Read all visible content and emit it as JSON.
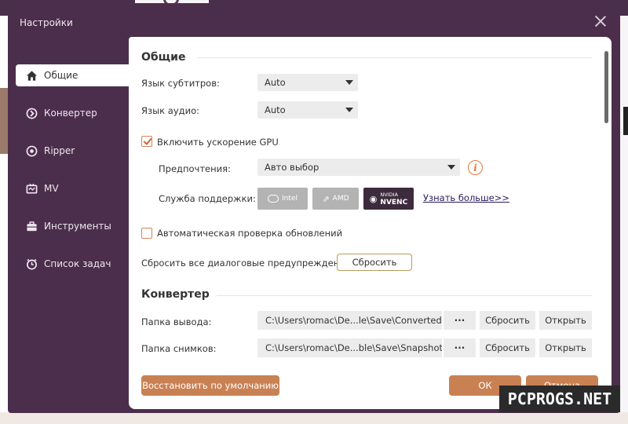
{
  "window": {
    "title": "Настройки"
  },
  "sidebar": {
    "items": [
      {
        "label": "Общие",
        "icon": "home-icon",
        "active": true
      },
      {
        "label": "Конвертер",
        "icon": "converter-icon",
        "active": false
      },
      {
        "label": "Ripper",
        "icon": "disc-icon",
        "active": false
      },
      {
        "label": "MV",
        "icon": "tv-icon",
        "active": false
      },
      {
        "label": "Инструменты",
        "icon": "toolbox-icon",
        "active": false
      },
      {
        "label": "Список задач",
        "icon": "clock-icon",
        "active": false
      }
    ]
  },
  "general": {
    "title": "Общие",
    "subtitle_lang_label": "Язык субтитров:",
    "subtitle_lang_value": "Auto",
    "audio_lang_label": "Язык аудио:",
    "audio_lang_value": "Auto",
    "gpu_checkbox_label": "Включить ускорение GPU",
    "gpu_checked": true,
    "preference_label": "Предпочтения:",
    "preference_value": "Авто выбор",
    "support_label": "Служба поддержки:",
    "gpu_intel": "Intel",
    "gpu_amd": "AMD",
    "gpu_nvidia_top": "NVIDIA",
    "gpu_nvidia_bottom": "NVENC",
    "learn_more": "Узнать больше>>",
    "auto_update_label": "Автоматическая проверка обновлений",
    "auto_update_checked": false,
    "reset_dialogs_label": "Сбросить все диалоговые предупреждения:",
    "reset_button": "Сбросить"
  },
  "converter": {
    "title": "Конвертер",
    "output_label": "Папка вывода:",
    "output_path": "C:\\Users\\romac\\De...le\\Save\\Converted",
    "snapshot_label": "Папка снимков:",
    "snapshot_path": "C:\\Users\\romac\\De...ble\\Save\\Snapshot",
    "dots": "···",
    "reset_label": "Сбросить",
    "open_label": "Открыть"
  },
  "footer": {
    "restore_defaults": "Восстановить по умолчанию",
    "ok": "ОК",
    "cancel": "Отмена"
  },
  "watermark": "PCPROGS.NET",
  "colors": {
    "accent": "#c98154",
    "sidebar": "#4b2e4b",
    "nvidia_active": "#3d2b3d"
  }
}
